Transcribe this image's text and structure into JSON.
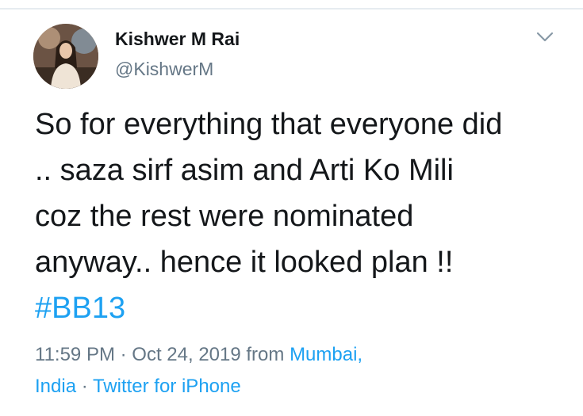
{
  "tweet": {
    "author_name": "Kishwer M Rai",
    "author_handle": "@KishwerM",
    "text_lines": [
      "So for everything that everyone did",
      ".. saza sirf asim and Arti Ko Mili",
      "coz the rest were nominated",
      "anyway.. hence it looked plan !!"
    ],
    "hashtag": "#BB13",
    "time": "11:59 PM",
    "separator": " · ",
    "date": "Oct 24, 2019",
    "from_label": " from ",
    "location_part1": "Mumbai,",
    "location_part2": "India",
    "source": "Twitter for iPhone"
  },
  "icons": {
    "menu": "chevron-down-icon",
    "avatar": "profile-photo"
  },
  "colors": {
    "text": "#14171a",
    "secondary": "#657786",
    "link": "#1da1f2",
    "border": "#e6ecf0"
  }
}
